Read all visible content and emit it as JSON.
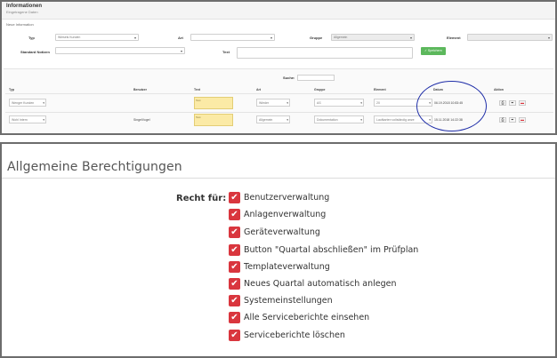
{
  "top": {
    "title": "Informationen",
    "subtitle": "Eingetragene Daten",
    "section": "Neue Information",
    "labels": {
      "typ": "Typ",
      "art": "Art",
      "gruppe": "Gruppe",
      "element": "Element",
      "standard_notizen": "Standard Notizen",
      "text": "Text"
    },
    "values": {
      "typ": "Wiesels Kunden",
      "gruppe": "Allgemein"
    },
    "save_label": "Speichern",
    "search_label": "Suche:",
    "table": {
      "headers": [
        "Typ",
        "Benutzer",
        "Text",
        "Art",
        "Gruppe",
        "Element",
        "Datum",
        "Aktion"
      ],
      "rows": [
        {
          "typ": "Wenger Kunden",
          "benutzer": "",
          "text": "Test",
          "art": "Wieder",
          "gruppe": "AS",
          "element": "20",
          "datum": "06.19.2018 10:83:45"
        },
        {
          "typ": "Wohl Intern",
          "benutzer": "SingelVogel",
          "text": "Test",
          "art": "Allgemein",
          "gruppe": "Dokumentation",
          "element": "Laufkarten vollständig anze",
          "datum": "15.11.2018 14:22:38"
        }
      ],
      "action_icons": [
        "print-icon",
        "edit-icon",
        "delete-icon"
      ]
    },
    "highlight_color": "#1f2ea8"
  },
  "bottom": {
    "title": "Allgemeine Berechtigungen",
    "recht_label": "Recht für:",
    "checkbox_color": "#d9363e",
    "permissions": [
      {
        "label": "Benutzerverwaltung",
        "checked": true
      },
      {
        "label": "Anlagenverwaltung",
        "checked": true
      },
      {
        "label": "Geräteverwaltung",
        "checked": true
      },
      {
        "label": "Button \"Quartal abschließen\" im Prüfplan",
        "checked": true
      },
      {
        "label": "Templateverwaltung",
        "checked": true
      },
      {
        "label": "Neues Quartal automatisch anlegen",
        "checked": true
      },
      {
        "label": "Systemeinstellungen",
        "checked": true
      },
      {
        "label": "Alle Serviceberichte einsehen",
        "checked": true
      },
      {
        "label": "Serviceberichte löschen",
        "checked": true
      }
    ]
  }
}
